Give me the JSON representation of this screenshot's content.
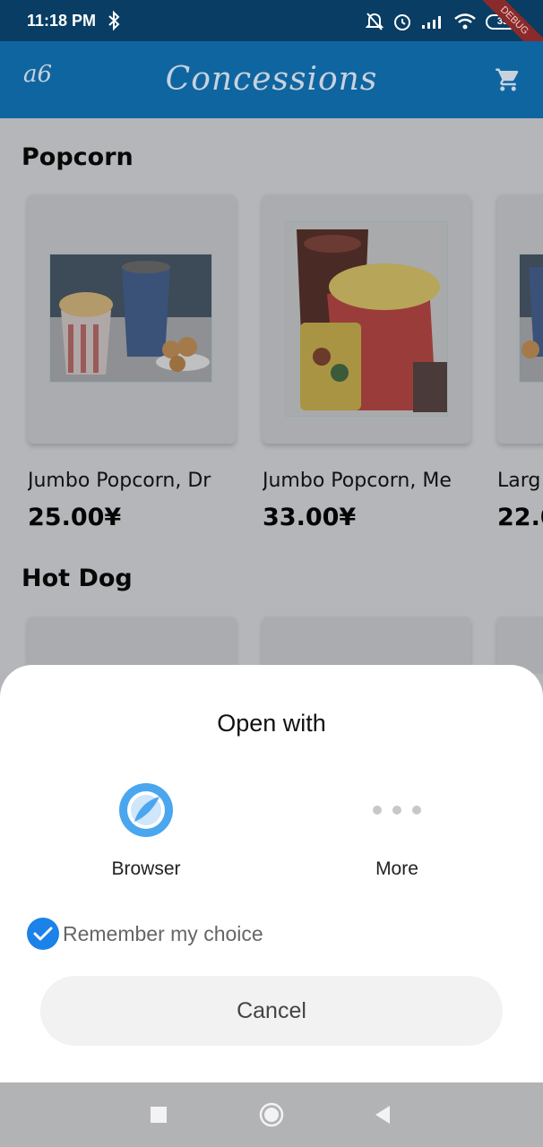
{
  "status_bar": {
    "time": "11:18 PM",
    "battery": "35",
    "debug_banner": "DEBUG"
  },
  "app_bar": {
    "leading_text": "a6",
    "title": "Concessions",
    "cart_icon": "shopping-cart-icon"
  },
  "sections": [
    {
      "title": "Popcorn",
      "items": [
        {
          "name": "Jumbo Popcorn, Dr",
          "price": "25.00¥"
        },
        {
          "name": "Jumbo Popcorn, Me",
          "price": "33.00¥"
        },
        {
          "name": "Larg",
          "price": "22.0"
        }
      ]
    },
    {
      "title": "Hot Dog",
      "items": []
    }
  ],
  "sheet": {
    "title": "Open with",
    "options": [
      {
        "label": "Browser",
        "icon": "browser-icon"
      },
      {
        "label": "More",
        "icon": "more-dots-icon"
      }
    ],
    "remember_label": "Remember my choice",
    "remember_checked": true,
    "cancel_label": "Cancel"
  },
  "colors": {
    "status_bar": "#093d63",
    "app_bar": "#0f65a0",
    "accent": "#1a82e8",
    "browser_icon": "#4aa6ee"
  }
}
